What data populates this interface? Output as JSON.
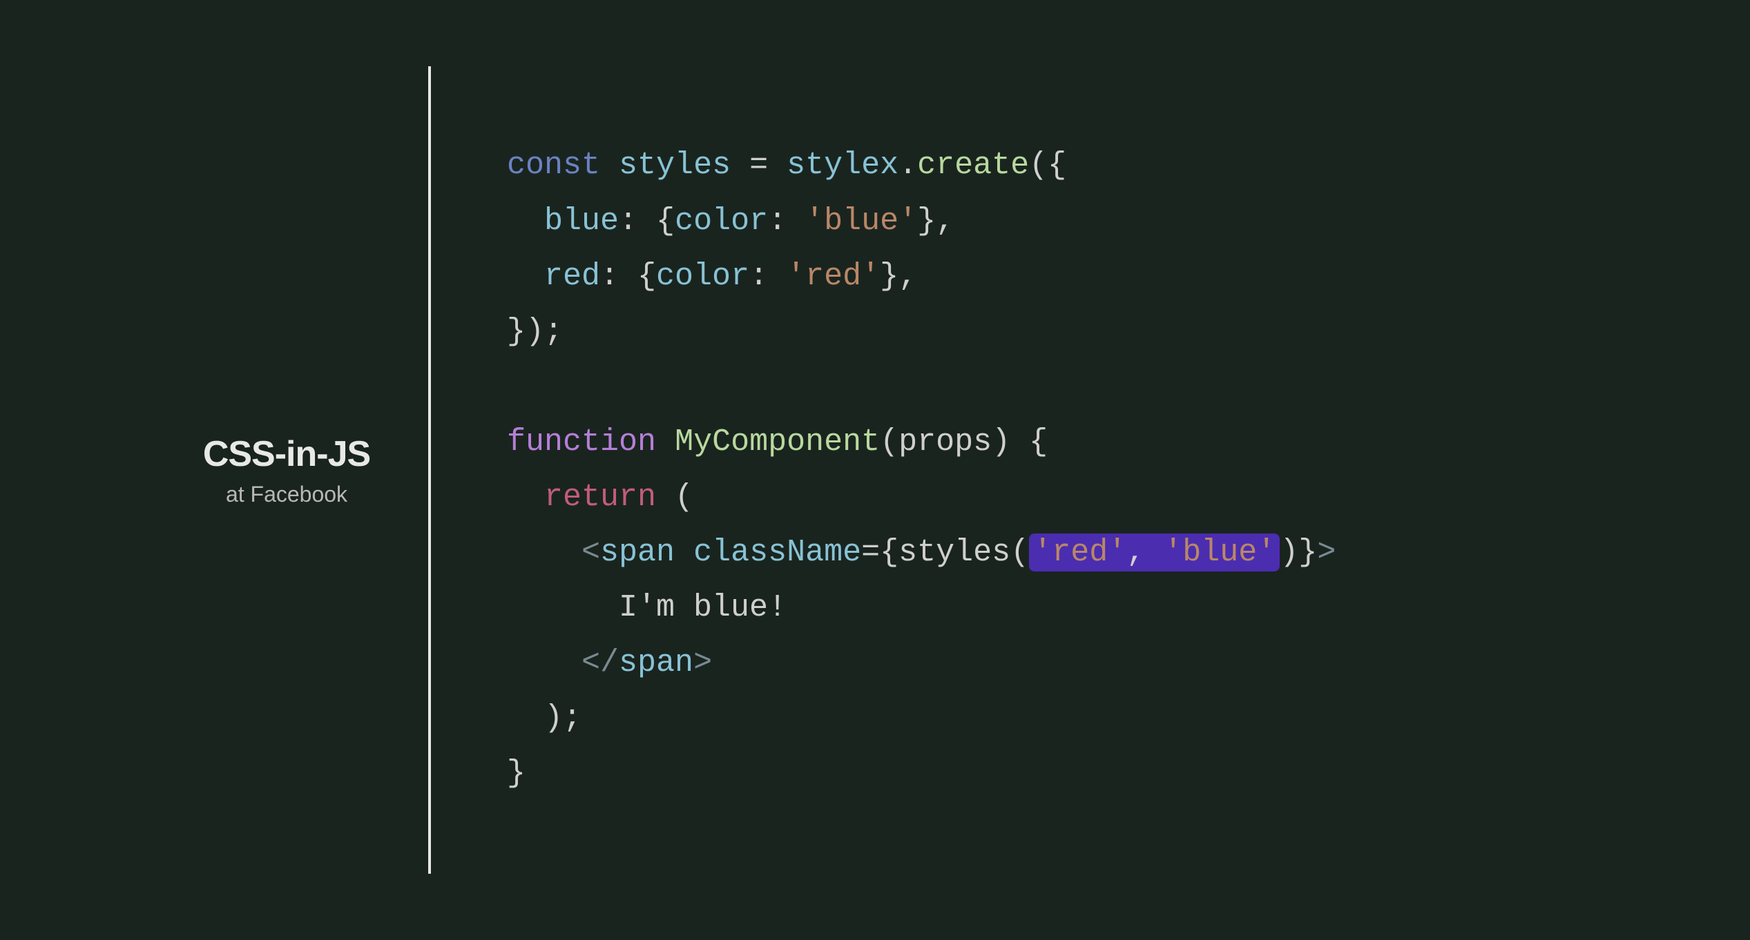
{
  "sidebar": {
    "title": "CSS-in-JS",
    "subtitle": "at Facebook"
  },
  "code": {
    "line1": {
      "kw_const": "const",
      "var_styles": "styles",
      "eq": " = ",
      "obj_stylex": "stylex",
      "dot": ".",
      "method_create": "create",
      "open": "({"
    },
    "line2": {
      "indent": "  ",
      "prop_blue": "blue",
      "colon": ": {",
      "prop_color": "color",
      "colon2": ": ",
      "str_blue": "'blue'",
      "close": "},"
    },
    "line3": {
      "indent": "  ",
      "prop_red": "red",
      "colon": ": {",
      "prop_color": "color",
      "colon2": ": ",
      "str_red": "'red'",
      "close": "},"
    },
    "line4": {
      "close": "});"
    },
    "line6": {
      "kw_function": "function",
      "fn_name": "MyComponent",
      "open": "(",
      "param": "props",
      "close": ") {"
    },
    "line7": {
      "indent": "  ",
      "kw_return": "return",
      "paren": " ("
    },
    "line8": {
      "indent": "    ",
      "lt": "<",
      "tag": "span",
      "sp": " ",
      "attr": "className",
      "eq_brace": "={",
      "call": "styles",
      "open_p": "(",
      "str_red": "'red'",
      "comma": ", ",
      "str_blue": "'blue'",
      "close_p": ")",
      "close_brace": "}",
      "gt": ">"
    },
    "line9": {
      "indent": "      ",
      "text": "I'm blue!"
    },
    "line10": {
      "indent": "    ",
      "lt": "</",
      "tag": "span",
      "gt": ">"
    },
    "line11": {
      "indent": "  ",
      "close": ");"
    },
    "line12": {
      "close": "}"
    }
  }
}
